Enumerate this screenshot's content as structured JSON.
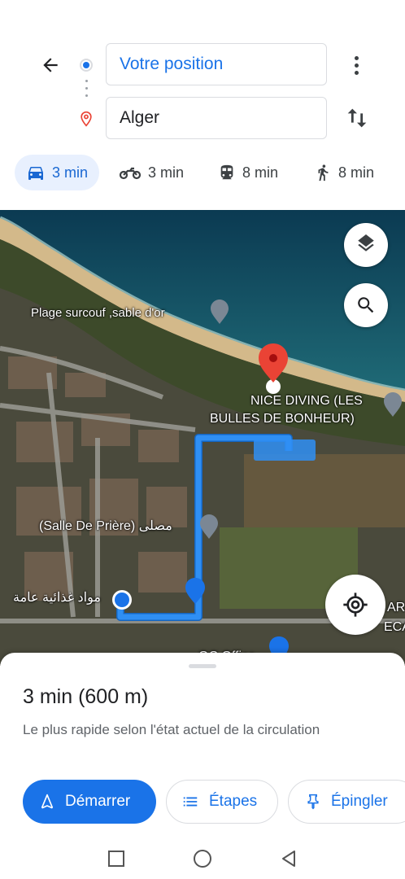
{
  "header": {
    "origin_value": "Votre position",
    "destination_value": "Alger",
    "icons": {
      "back": "back-arrow-icon",
      "more": "more-vert-icon",
      "swap": "swap-icon"
    }
  },
  "modes": [
    {
      "name": "car",
      "label": "3 min",
      "active": true
    },
    {
      "name": "motorcycle",
      "label": "3 min",
      "active": false
    },
    {
      "name": "transit",
      "label": "8 min",
      "active": false
    },
    {
      "name": "walk",
      "label": "8 min",
      "active": false
    }
  ],
  "map": {
    "labels": {
      "beach": "Plage surcouf ,sable d'or",
      "dive_line1": "NICE DIVING (LES",
      "dive_line2": "BULLES DE BONHEUR)",
      "prayer": "(Salle De Prière) مصلى",
      "food": "مواد غذائية عامة",
      "partial_right_1": "AR",
      "partial_right_2": "ECA",
      "partial_bottom": "QC Office"
    },
    "colors": {
      "route": "#2f8ff4",
      "destination_pin": "#ea4335",
      "sea": "#0f4a60"
    }
  },
  "sheet": {
    "summary": "3 min (600 m)",
    "description": "Le plus rapide selon l'état actuel de la circulation",
    "start_label": "Démarrer",
    "steps_label": "Étapes",
    "pin_label": "Épingler"
  },
  "colors": {
    "accent": "#1a73e8",
    "active_mode_bg": "#e8f0fe"
  }
}
